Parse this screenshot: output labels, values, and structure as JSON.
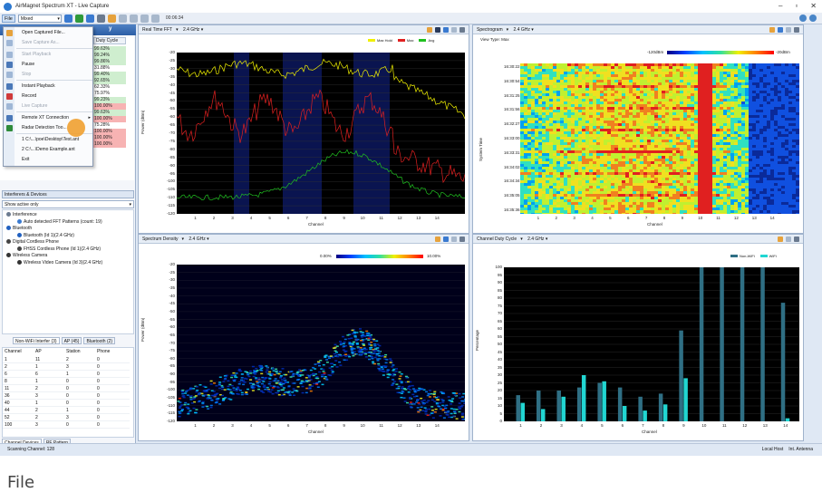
{
  "window": {
    "title": "AirMagnet Spectrum XT - Live Capture"
  },
  "toolbar": {
    "file_label": "File",
    "mode_value": "Mixed",
    "timer": "00:06:34"
  },
  "left_panel": {
    "title": "y",
    "mini_header": "Duty Cycle",
    "mini_values": [
      "99.63%",
      "99.24%",
      "99.86%",
      "31.88%",
      "99.40%",
      "92.65%",
      "62.33%",
      "75.97%",
      "99.23%",
      "100.00%",
      "99.63%",
      "100.00%",
      "75.28%",
      "100.00%",
      "100.00%",
      "100.00%"
    ],
    "menu": [
      {
        "label": "Open Captured File...",
        "enabled": true,
        "color": "#e6a23c"
      },
      {
        "label": "Save Capture As...",
        "enabled": false,
        "color": "#9fb7d6"
      },
      {
        "label": "Start Playback",
        "enabled": false,
        "color": "#9fb7d6"
      },
      {
        "label": "Pause",
        "enabled": true,
        "color": "#4a78b8"
      },
      {
        "label": "Stop",
        "enabled": false,
        "color": "#9fb7d6"
      },
      {
        "label": "Instant Playback",
        "enabled": true,
        "color": "#4a78b8"
      },
      {
        "label": "Record",
        "enabled": true,
        "color": "#d03a3a"
      },
      {
        "label": "Live Capture",
        "enabled": false,
        "color": "#9fb7d6"
      },
      {
        "label": "Remote XT Connection",
        "enabled": true,
        "color": "#4a78b8"
      },
      {
        "label": "Radar Detection Too...",
        "enabled": true,
        "color": "#2e8b3a"
      },
      {
        "label": "1 C:\\...\\poe\\Desktop\\Test.ant",
        "enabled": true,
        "color": ""
      },
      {
        "label": "2 C:\\...\\Demo Example.ant",
        "enabled": true,
        "color": ""
      },
      {
        "label": "Exit",
        "enabled": true,
        "color": ""
      }
    ],
    "interferers_header": "Interferers & Devices",
    "show_select": "Show active only",
    "tree": [
      {
        "label": "Interference",
        "indent": 0,
        "color": "#6b7a8f"
      },
      {
        "label": "Auto detected FFT Patterns (count: 19)",
        "indent": 1,
        "color": "#3a7ad0"
      },
      {
        "label": "Bluetooth",
        "indent": 0,
        "color": "#2060c0"
      },
      {
        "label": "Bluetooth (Id 1)(2.4 GHz)",
        "indent": 1,
        "color": "#2060c0"
      },
      {
        "label": "Digital Cordless Phone",
        "indent": 0,
        "color": "#444"
      },
      {
        "label": "FHSS Cordless Phone (Id 1)(2.4 GHz)",
        "indent": 1,
        "color": "#444"
      },
      {
        "label": "Wireless Camera",
        "indent": 0,
        "color": "#333"
      },
      {
        "label": "Wireless Video Camera (Id 3)(2.4 GHz)",
        "indent": 1,
        "color": "#333"
      }
    ],
    "tabs_top": [
      "Non-WiFi Interfer (3)",
      "AP (45)",
      "Bluetooth (2)"
    ],
    "grid_headers": [
      "Channel",
      "AP",
      "Station",
      "Phone"
    ],
    "grid_rows": [
      [
        "1",
        "11",
        "2",
        "0"
      ],
      [
        "2",
        "1",
        "3",
        "0"
      ],
      [
        "6",
        "6",
        "1",
        "0"
      ],
      [
        "8",
        "1",
        "0",
        "0"
      ],
      [
        "11",
        "2",
        "0",
        "0"
      ],
      [
        "36",
        "3",
        "0",
        "0"
      ],
      [
        "40",
        "1",
        "0",
        "0"
      ],
      [
        "44",
        "2",
        "1",
        "0"
      ],
      [
        "52",
        "2",
        "3",
        "0"
      ],
      [
        "100",
        "3",
        "0",
        "0"
      ]
    ],
    "tabs_bottom": [
      "Channel Devices",
      "RF Pattern"
    ]
  },
  "panes": {
    "fft": {
      "title": "Real Time FFT",
      "band": "2.4 GHz",
      "legend": [
        {
          "name": "Max Hold",
          "color": "#f0f000"
        },
        {
          "name": "Max",
          "color": "#e02020"
        },
        {
          "name": "Avg",
          "color": "#20c020"
        }
      ],
      "ylabel": "Power (dBm)",
      "xlabel": "Channel",
      "yticks": [
        "-20",
        "-25",
        "-30",
        "-35",
        "-40",
        "-45",
        "-50",
        "-55",
        "-60",
        "-65",
        "-70",
        "-75",
        "-80",
        "-85",
        "-90",
        "-95",
        "-100",
        "-105",
        "-110",
        "-115",
        "-120"
      ],
      "xticks": [
        "1",
        "2",
        "3",
        "4",
        "5",
        "6",
        "7",
        "8",
        "9",
        "10",
        "11",
        "12",
        "13",
        "14"
      ]
    },
    "spectrogram": {
      "title": "Spectrogram",
      "band": "2.4 GHz",
      "view_type": "View Type: Max",
      "ylabel": "System Time",
      "xlabel": "Channel",
      "scale_left": "-120dBm",
      "scale_right": "-20dBm",
      "times": [
        "16:30:22",
        "16:30:54",
        "16:31:25",
        "16:31:56",
        "16:32:27",
        "16:33:00",
        "16:33:31",
        "16:34:02",
        "16:34:34",
        "16:35:05",
        "16:35:36"
      ],
      "xticks": [
        "1",
        "2",
        "3",
        "4",
        "5",
        "6",
        "7",
        "8",
        "9",
        "10",
        "11",
        "12",
        "13",
        "14"
      ]
    },
    "density": {
      "title": "Spectrum Density",
      "band": "2.4 GHz",
      "scale_left": "0.00%",
      "scale_right": "10.00%",
      "ylabel": "Power (dBm)",
      "xlabel": "Channel",
      "yticks": [
        "-20",
        "-25",
        "-30",
        "-35",
        "-40",
        "-45",
        "-50",
        "-55",
        "-60",
        "-65",
        "-70",
        "-75",
        "-80",
        "-85",
        "-90",
        "-95",
        "-100",
        "-105",
        "-110",
        "-115",
        "-120"
      ],
      "xticks": [
        "1",
        "2",
        "3",
        "4",
        "5",
        "6",
        "7",
        "8",
        "9",
        "10",
        "11",
        "12",
        "13",
        "14"
      ]
    },
    "duty": {
      "title": "Channel Duty Cycle",
      "band": "2.4 GHz",
      "legend": [
        {
          "name": "Non-WiFi",
          "color": "#2f6f84"
        },
        {
          "name": "WiFi",
          "color": "#21d6d2"
        }
      ],
      "ylabel": "Percentage",
      "xlabel": "Channel",
      "yticks": [
        "100",
        "95",
        "90",
        "85",
        "80",
        "75",
        "70",
        "65",
        "60",
        "55",
        "50",
        "45",
        "40",
        "35",
        "30",
        "25",
        "20",
        "15",
        "10",
        "5",
        "0"
      ]
    }
  },
  "chart_data": {
    "type": "bar",
    "categories": [
      "1",
      "2",
      "3",
      "4",
      "5",
      "6",
      "7",
      "8",
      "9",
      "10",
      "11",
      "12",
      "13",
      "14"
    ],
    "series": [
      {
        "name": "Non-WiFi",
        "values": [
          17,
          20,
          20,
          22,
          25,
          22,
          16,
          18,
          59,
          100,
          100,
          100,
          100,
          77
        ]
      },
      {
        "name": "WiFi",
        "values": [
          12,
          8,
          16,
          30,
          26,
          10,
          7,
          11,
          28,
          0,
          0,
          0,
          0,
          2
        ]
      }
    ],
    "xlabel": "Channel",
    "ylabel": "Percentage",
    "ylim": [
      0,
      100
    ]
  },
  "status": {
    "left": "Scanning Channel: 128",
    "host": "Local Host",
    "antenna": "Int. Antenna"
  },
  "caption": "File"
}
